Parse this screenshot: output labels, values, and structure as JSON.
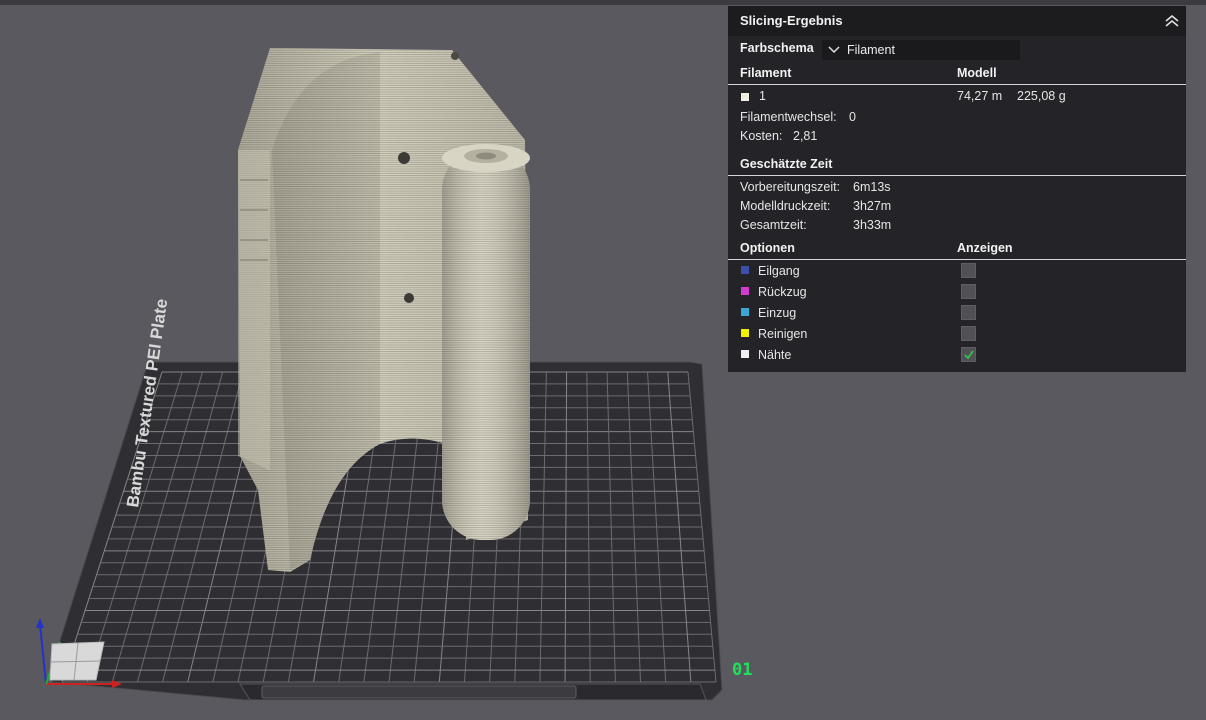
{
  "viewport": {
    "plate_label": "Bambu Textured PEI Plate",
    "plate_number": "01"
  },
  "panel": {
    "title": "Slicing-Ergebnis",
    "color_scheme": {
      "label": "Farbschema",
      "value": "Filament"
    },
    "columns": {
      "filament": "Filament",
      "model": "Modell"
    },
    "filament_row": {
      "index": "1",
      "length": "74,27 m",
      "weight": "225,08 g",
      "color": "#f0efe2"
    },
    "filament_changes": {
      "label": "Filamentwechsel:",
      "value": "0"
    },
    "cost": {
      "label": "Kosten:",
      "value": "2,81"
    },
    "time": {
      "title": "Geschätzte Zeit",
      "prep_label": "Vorbereitungszeit:",
      "prep_value": "6m13s",
      "print_label": "Modelldruckzeit:",
      "print_value": "3h27m",
      "total_label": "Gesamtzeit:",
      "total_value": "3h33m"
    },
    "options": {
      "title": "Optionen",
      "show_title": "Anzeigen",
      "items": [
        {
          "label": "Eilgang",
          "color": "#3b4fa8",
          "checked": false
        },
        {
          "label": "Rückzug",
          "color": "#d23ad0",
          "checked": false
        },
        {
          "label": "Einzug",
          "color": "#3aa7d8",
          "checked": false
        },
        {
          "label": "Reinigen",
          "color": "#f2f200",
          "checked": false
        },
        {
          "label": "Nähte",
          "color": "#f0f0f0",
          "checked": true
        }
      ]
    }
  }
}
